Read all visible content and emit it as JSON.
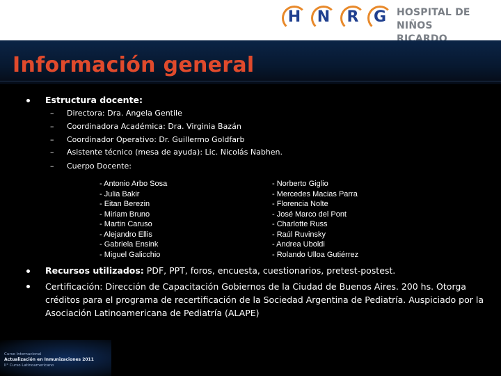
{
  "header": {
    "logo_letters": [
      "H",
      "N",
      "R",
      "G"
    ],
    "hospital_line1": "HOSPITAL DE NIÑOS",
    "hospital_line2": "RICARDO GUTIÉRREZ"
  },
  "title": "Información general",
  "estructura": {
    "label": "Estructura docente:",
    "items": [
      "Directora: Dra. Angela Gentile",
      "Coordinadora Académica: Dra. Virginia Bazán",
      "Coordinador Operativo: Dr. Guillermo Goldfarb",
      "Asistente técnico (mesa de ayuda): Lic. Nicolás Nabhen.",
      "Cuerpo Docente:"
    ],
    "docentes_col1": [
      "- Antonio Arbo Sosa",
      "- Julia Bakir",
      "- Eitan Berezin",
      "- Miriam Bruno",
      "- Martin Caruso",
      "- Alejandro Ellis",
      "- Gabriela Ensink",
      "- Miguel Galicchio"
    ],
    "docentes_col2": [
      "- Norberto Giglio",
      "- Mercedes Macias Parra",
      "- Florencia Nolte",
      "- José Marco del Pont",
      "- Charlotte Russ",
      "- Raúl Ruvinsky",
      "- Andrea Uboldi",
      "- Rolando Ulloa Gutiérrez"
    ]
  },
  "recursos": {
    "label": "Recursos utilizados:",
    "value": " PDF, PPT, foros, encuesta, cuestionarios, pretest-postest."
  },
  "certificacion": "Certificación: Dirección de Capacitación Gobiernos de la Ciudad de Buenos Aires. 200 hs. Otorga créditos para el programa de recertificación de la Sociedad Argentina de Pediatría. Auspiciado por la Asociación Latinoamericana de Pediatría (ALAPE)",
  "footer_logo": {
    "line1": "Curso Internacional",
    "line2": "Actualización en Inmunizaciones 2011",
    "line3": "II° Curso Latinoamericano"
  },
  "colors": {
    "title": "#e04a2c",
    "logo_blue": "#1f3f8f",
    "logo_orange": "#e8892a"
  }
}
